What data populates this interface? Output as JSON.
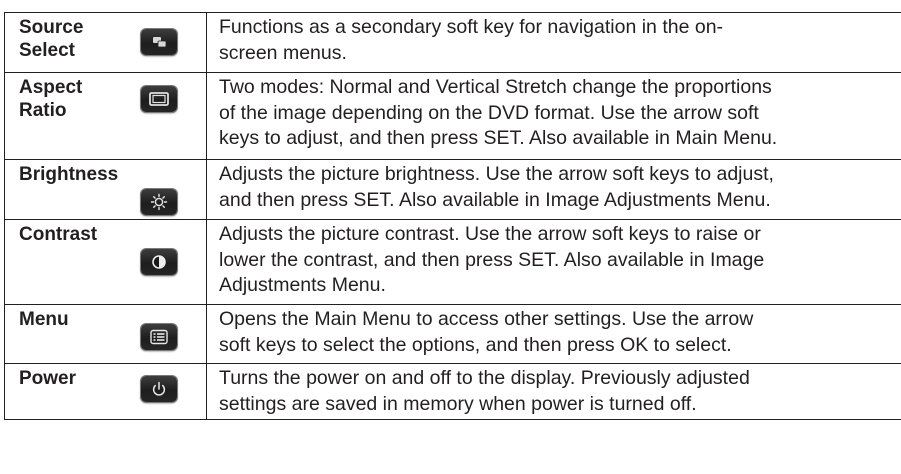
{
  "rows": [
    {
      "name": "Source\nSelect",
      "icon": "source-select-icon",
      "description": "Functions as a secondary soft key for navigation in the on-\nscreen menus."
    },
    {
      "name": "Aspect\nRatio",
      "icon": "aspect-ratio-icon",
      "description": "Two modes: Normal and Vertical Stretch change the proportions\nof the image depending on the DVD format. Use the arrow soft\nkeys to adjust, and then press SET. Also available in Main Menu."
    },
    {
      "name": "Brightness",
      "icon": "brightness-sun-icon",
      "description": "Adjusts the picture brightness. Use the arrow soft keys to adjust,\nand then press SET. Also available in Image Adjustments Menu."
    },
    {
      "name": "Contrast",
      "icon": "contrast-icon",
      "description": "Adjusts the picture contrast. Use the arrow soft keys to raise or\nlower the contrast, and then press SET. Also available in Image\nAdjustments Menu."
    },
    {
      "name": "Menu",
      "icon": "menu-list-icon",
      "description": "Opens the Main Menu to access other settings. Use the arrow\nsoft keys to select the options, and then press OK to select."
    },
    {
      "name": "Power",
      "icon": "power-icon",
      "description": "Turns the power on and off to the display. Previously adjusted\nsettings are saved in memory when power is turned off."
    }
  ]
}
